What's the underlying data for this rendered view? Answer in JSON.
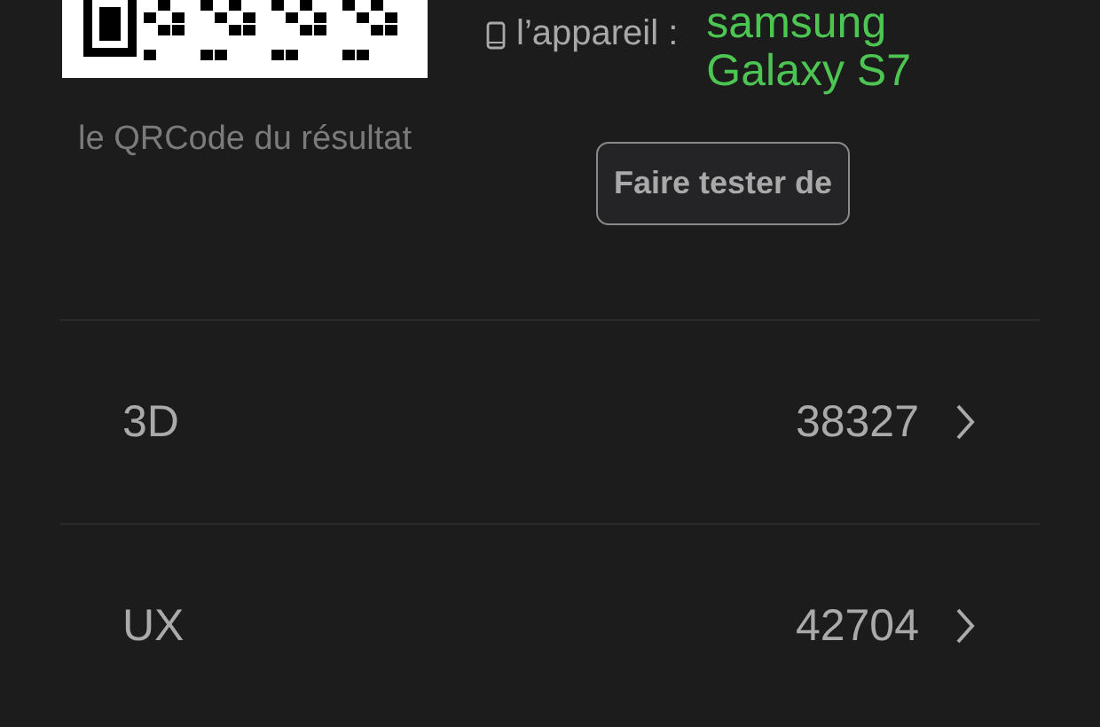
{
  "qr_caption": "le QRCode du résultat",
  "device": {
    "label": "l’appareil :",
    "name_lines": [
      "samsung",
      "Galaxy S7"
    ]
  },
  "test_button": "Faire tester de",
  "scores": [
    {
      "label": "3D",
      "value": "38327"
    },
    {
      "label": "UX",
      "value": "42704"
    }
  ]
}
